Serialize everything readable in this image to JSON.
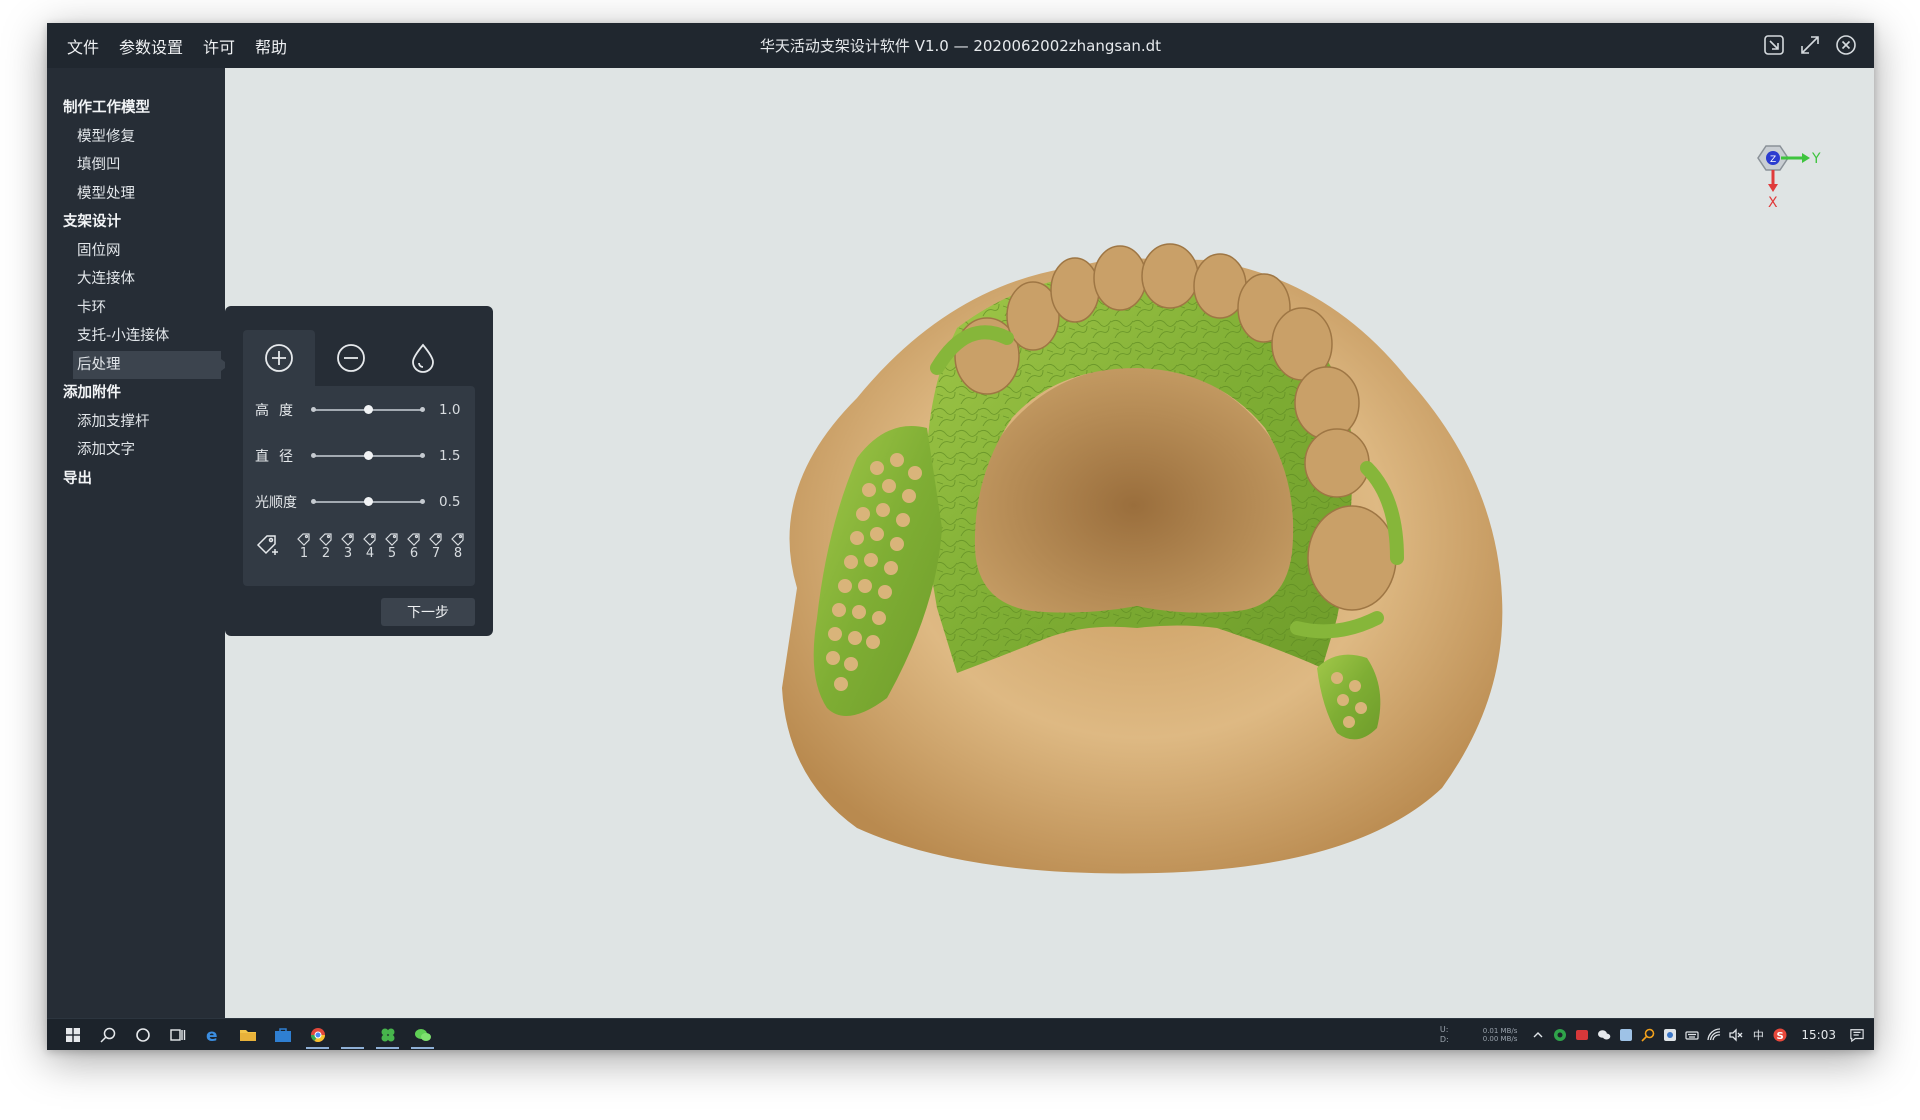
{
  "menu": [
    "文件",
    "参数设置",
    "许可",
    "帮助"
  ],
  "window": {
    "title": "华天活动支架设计软件 V1.0 — 2020062002zhangsan.dt"
  },
  "sidebar": {
    "groups": [
      {
        "label": "制作工作模型",
        "items": [
          "模型修复",
          "填倒凹",
          "模型处理"
        ]
      },
      {
        "label": "支架设计",
        "items": [
          "固位网",
          "大连接体",
          "卡环",
          "支托-小连接体",
          "后处理"
        ]
      },
      {
        "label": "添加附件",
        "items": [
          "添加支撑杆",
          "添加文字"
        ]
      },
      {
        "label": "导出",
        "items": []
      }
    ],
    "active_item": "后处理"
  },
  "panel": {
    "tools": [
      "add-icon",
      "subtract-icon",
      "smooth-drop-icon"
    ],
    "params": [
      {
        "label": "高度",
        "value": "1.0",
        "level": 0.5
      },
      {
        "label": "直径",
        "value": "1.5",
        "level": 0.5
      },
      {
        "label": "光顺度",
        "value": "0.5",
        "level": 0.5
      }
    ],
    "tags": [
      "1",
      "2",
      "3",
      "4",
      "5",
      "6",
      "7",
      "8"
    ],
    "next_label": "下一步"
  },
  "gizmo": {
    "y_label": "Y",
    "x_label": "X",
    "z_label": "Z"
  },
  "taskbar": {
    "net_up_label": "U:",
    "net_down_label": "D:",
    "net_up": "0.01 MB/s",
    "net_down": "0.00 MB/s",
    "ime": "中",
    "time": "15:03"
  },
  "colors": {
    "titlebar": "#20272f",
    "sidebar": "#262d36",
    "viewport": "#dfe4e4",
    "model_gold": "#d8b37a",
    "framework_green": "#86b63a"
  }
}
